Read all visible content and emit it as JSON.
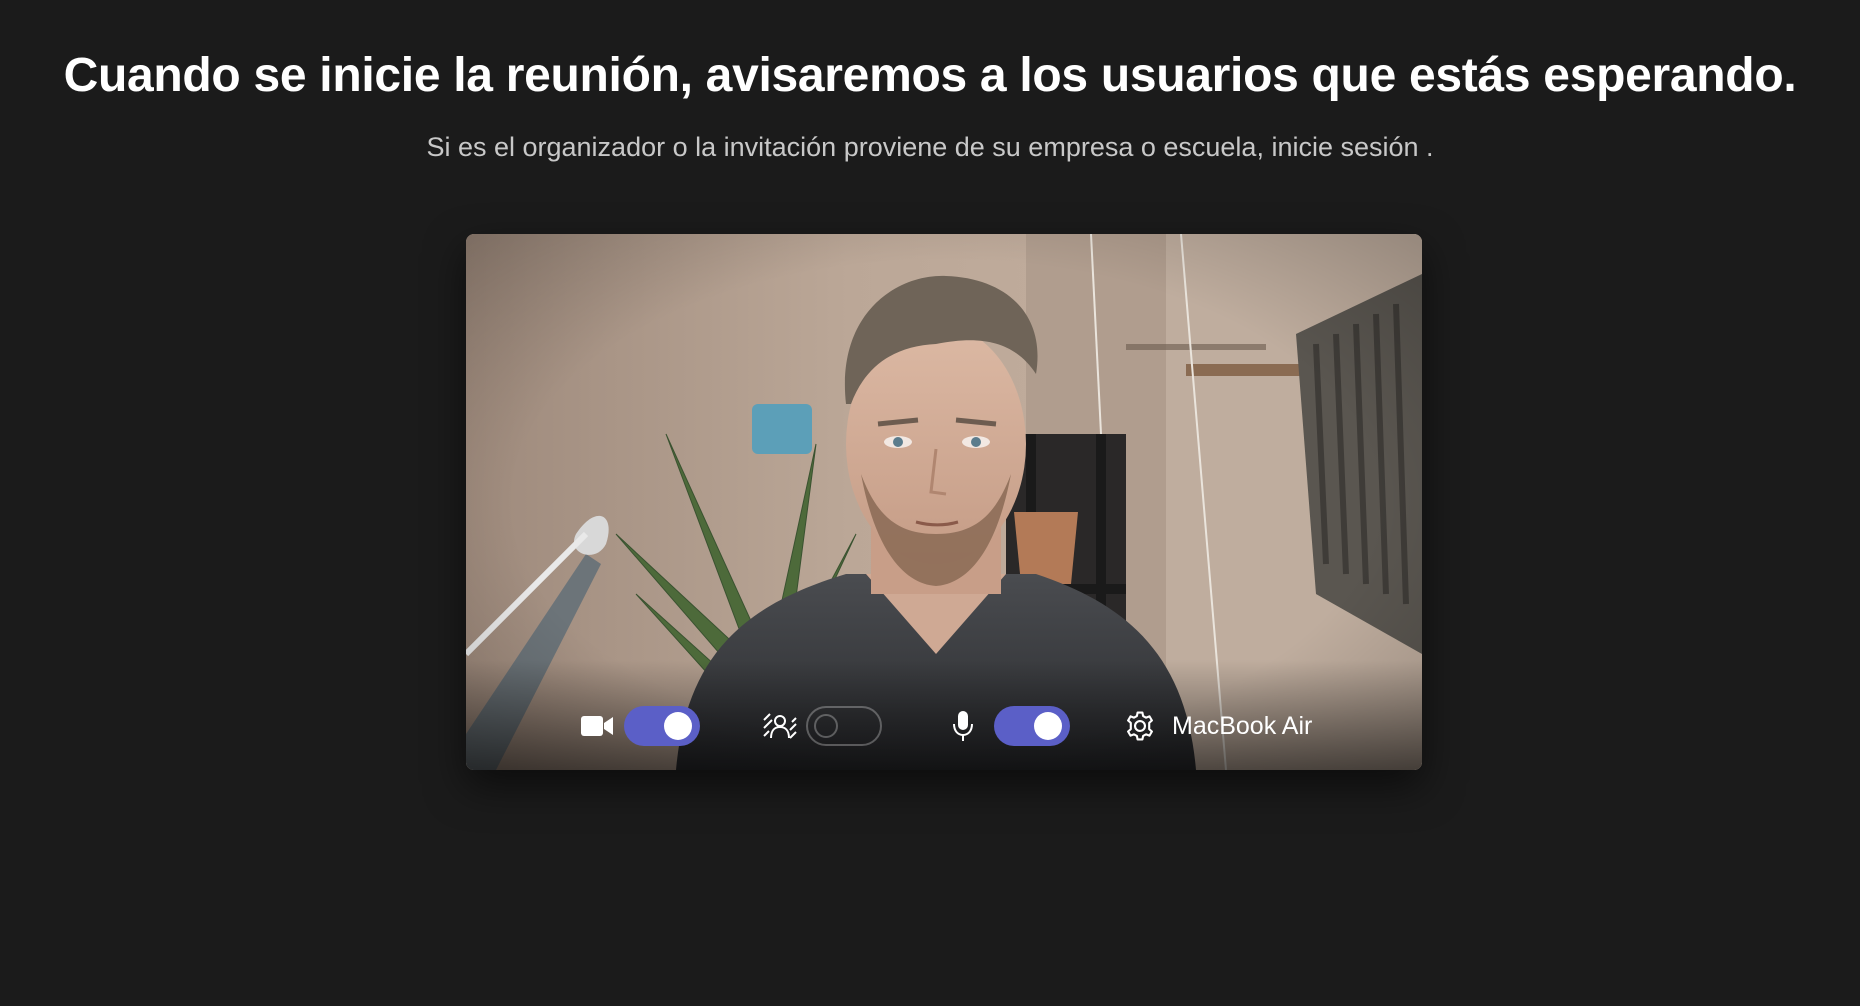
{
  "header": {
    "title": "Cuando se inicie la reunión, avisaremos a los usuarios que estás esperando.",
    "subtitle_prefix": "Si es el organizador o la invitación proviene de su empresa o escuela, ",
    "sign_in_link": "inicie sesión",
    "subtitle_suffix": " ."
  },
  "preview": {
    "controls": {
      "camera": {
        "icon": "video-camera-icon",
        "on": true
      },
      "background_effects": {
        "icon": "background-blur-icon",
        "on": false
      },
      "microphone": {
        "icon": "microphone-icon",
        "on": true
      },
      "device_settings": {
        "icon": "gear-icon",
        "label": "MacBook Air"
      }
    }
  },
  "colors": {
    "background": "#1b1b1b",
    "toggle_on": "#5b5fc7",
    "subtitle": "#c8c8c8"
  }
}
